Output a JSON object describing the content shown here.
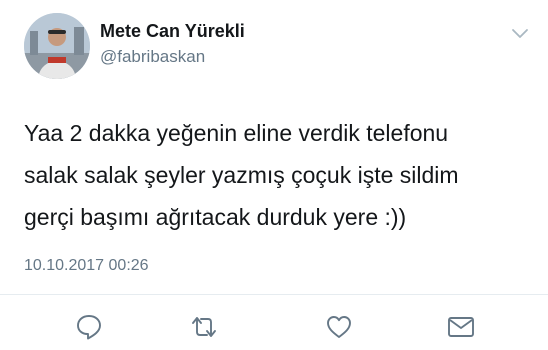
{
  "tweet": {
    "author_name": "Mete Can Yürekli",
    "author_handle": "@fabribaskan",
    "text_lines": [
      "Yaa 2 dakka yeğenin eline verdik telefonu",
      "salak salak şeyler yazmış çoçuk işte sildim",
      "gerçi başımı ağrıtacak durduk yere :))"
    ],
    "timestamp": "10.10.2017 00:26"
  },
  "icons": {
    "more": "chevron-down-icon",
    "reply": "reply-icon",
    "retweet": "retweet-icon",
    "like": "heart-icon",
    "message": "envelope-icon"
  },
  "colors": {
    "text": "#14171a",
    "secondary_text": "#657786",
    "icon": "#657786",
    "divider": "#e6ecf0"
  }
}
